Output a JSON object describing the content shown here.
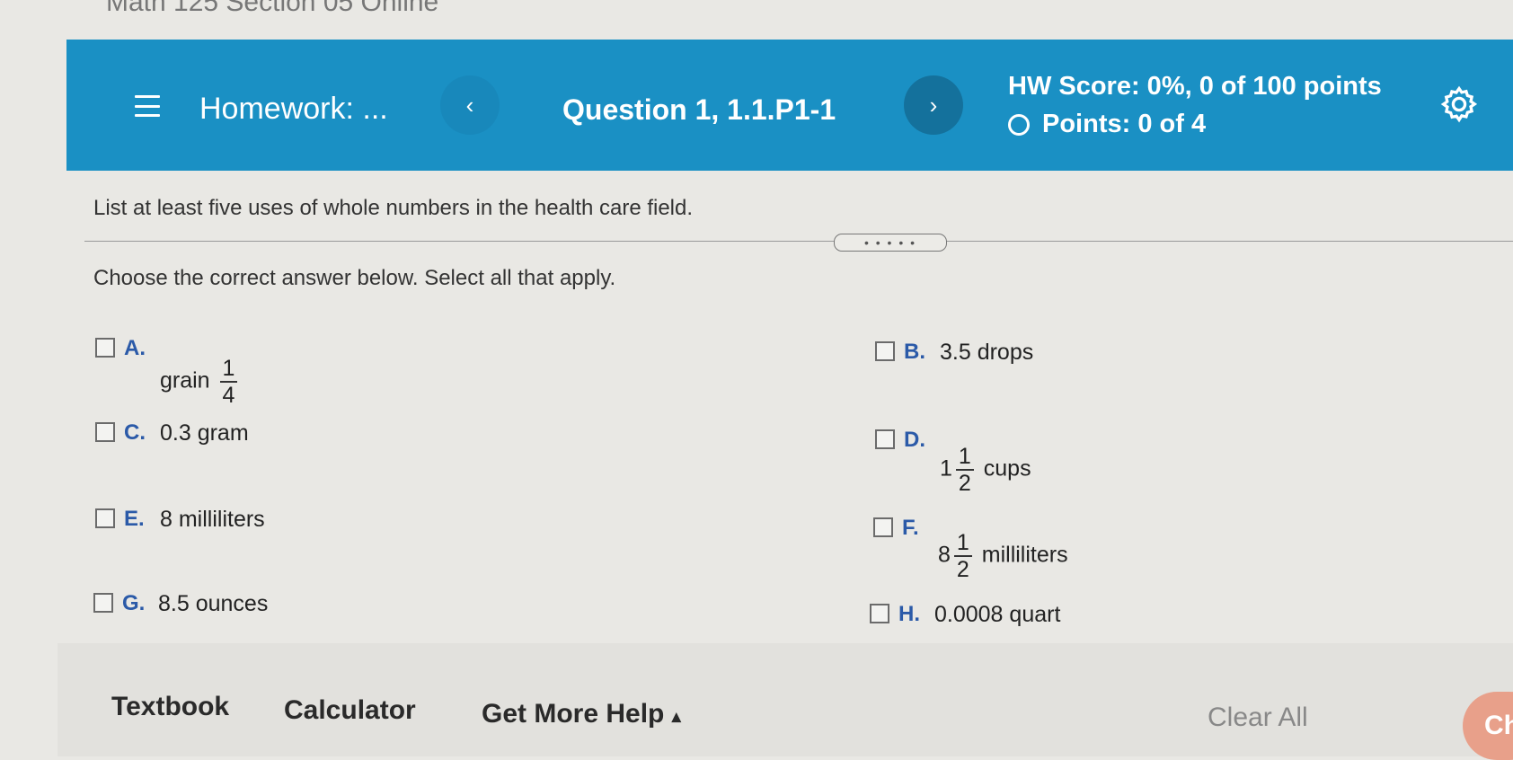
{
  "course_title": "Math 125 Section 05 Online",
  "header": {
    "homework_label": "Homework: ...",
    "question_label": "Question 1, 1.1.P1-1",
    "prev_symbol": "‹",
    "next_symbol": "›",
    "hw_score": "HW Score: 0%, 0 of 100 points",
    "points": "Points: 0 of 4",
    "accent_color": "#1a90c4"
  },
  "question": {
    "prompt": "List at least five uses of whole numbers in the health care field.",
    "divider_handle": "• • • • •",
    "instruction": "Choose the correct answer below. Select all that apply."
  },
  "options": [
    {
      "letter": "A.",
      "before": "grain",
      "frac_num": "1",
      "frac_den": "4",
      "after": ""
    },
    {
      "letter": "B.",
      "text": "3.5 drops"
    },
    {
      "letter": "C.",
      "text": "0.3 gram"
    },
    {
      "letter": "D.",
      "whole": "1",
      "frac_num": "1",
      "frac_den": "2",
      "after": "cups"
    },
    {
      "letter": "E.",
      "text": "8 milliliters"
    },
    {
      "letter": "F.",
      "whole": "8",
      "frac_num": "1",
      "frac_den": "2",
      "after": "milliliters"
    },
    {
      "letter": "G.",
      "text": "8.5 ounces"
    },
    {
      "letter": "H.",
      "text": "0.0008 quart"
    }
  ],
  "footer": {
    "textbook": "Textbook",
    "calculator": "Calculator",
    "get_more_help": "Get More Help",
    "help_caret": "▴",
    "clear_all": "Clear All",
    "check_answer_partial": "Ch"
  }
}
